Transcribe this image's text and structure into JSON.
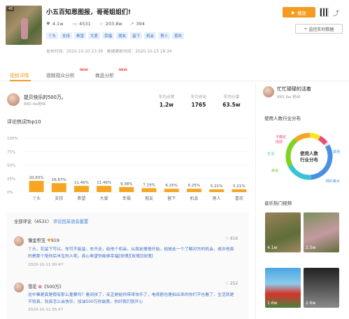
{
  "video": {
    "title": "小五百知恩图报，哥哥姐姐们!",
    "thumb_badge": "45",
    "likes": "4.1w",
    "comments": "4531",
    "favorites": "203.8w",
    "shares": "394",
    "tags": [
      "丫头",
      "支持",
      "希望",
      "大爱",
      "幸福",
      "朋友",
      "留下",
      "机会",
      "男人",
      "喜欢"
    ],
    "publish_label": "发布时间：",
    "publish_time": "2020-10-10 23:36",
    "data_update_label": "数据更新时间：",
    "data_update_time": "2020-10-15 18:34"
  },
  "actions": {
    "play": "播放",
    "monitor": "监控实时数据"
  },
  "tabs": [
    {
      "label": "视频详情",
      "new": ""
    },
    {
      "label": "视频观众分析",
      "new": "NEW"
    },
    {
      "label": "商品分析",
      "new": "NEW"
    }
  ],
  "author": {
    "name": "提贝快乐的500万。",
    "fans": "880.4w粉丝"
  },
  "summary": [
    {
      "label": "平均点赞",
      "value": "1.2w"
    },
    {
      "label": "平均评论",
      "value": "1765"
    },
    {
      "label": "平均分享",
      "value": "63.5w"
    }
  ],
  "chart_title": "评论热词Top10",
  "chart_data": {
    "type": "bar",
    "title": "评论热词Top10",
    "categories": [
      "丫头",
      "支持",
      "希望",
      "大爱",
      "幸福",
      "朋友",
      "留下",
      "机会",
      "男人",
      "喜欢"
    ],
    "values": [
      20.83,
      16.67,
      11.46,
      11.46,
      9.38,
      7.29,
      6.25,
      6.25,
      5.21,
      5.21
    ],
    "value_labels": [
      "20.83%",
      "16.67%",
      "11.46%",
      "11.46%",
      "9.38%",
      "7.29%",
      "6.25%",
      "6.25%",
      "5.21%",
      "5.21%"
    ],
    "yticks": [
      "100%",
      "75%",
      "50%",
      "25%",
      "0%"
    ],
    "ylim": [
      0,
      100
    ],
    "grid": true,
    "color": "#f6a623"
  },
  "comments_section": {
    "header": "全部评论（4531）",
    "link": "评论回采语音量置"
  },
  "comments": [
    {
      "user": "憧金积玉",
      "suffix": "919",
      "likes": "616",
      "text": "丫头，花留下可以，车可不能留，车开走，给他个机会，从朋友慢慢开始，给彼此一个了解对方的机会，或许他真的是那个陪你后半生的人呢，真心希望你能够幸福[玫瑰][玫瑰][玫瑰]",
      "time": "2020-10-11 00:47"
    },
    {
      "user": "雪花",
      "suffix": "《500万》",
      "likes": "252",
      "text": "这中事是真是假有那么重要吗？看到孩了，反正她给你带来快乐了，电视剧也是拍出来的你们不也看了，生活就是不较真，较真怎么会快乐，加油500万你最美，你好我们就开心",
      "time": "2020-10-11 05:47"
    }
  ],
  "right": {
    "account_name": "忙忙碌碌的活着",
    "account_fans": "865.6w 粉丝",
    "industry_title": "使用人数行业分布",
    "donut_center": "使用人数行业分布",
    "donut_labels": [
      "不确定",
      "情感",
      "生活",
      "美食",
      "其他",
      "网红美女"
    ],
    "popular_title": "音乐热门视频",
    "videos": [
      {
        "views": "4.1w"
      },
      {
        "views": "2.5w"
      },
      {
        "views": "1.6w"
      },
      {
        "views": "2.6w"
      }
    ]
  }
}
